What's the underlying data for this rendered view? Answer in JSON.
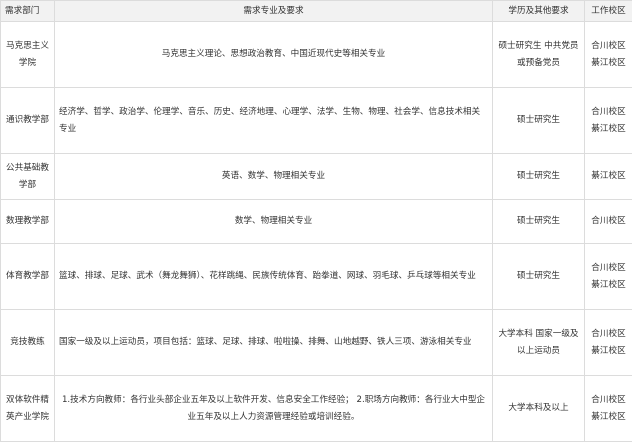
{
  "headers": {
    "dept": "需求部门",
    "spec": "需求专业及要求",
    "edu": "学历及其他要求",
    "campus": "工作校区"
  },
  "rows": [
    {
      "dept": "马克思主义学院",
      "spec": "马克思主义理论、思想政治教育、中国近现代史等相关专业",
      "edu": "硕士研究生 中共党员或预备党员",
      "campus": "合川校区 綦江校区"
    },
    {
      "dept": "通识教学部",
      "spec": "经济学、哲学、政治学、伦理学、音乐、历史、经济地理、心理学、法学、生物、物理、社会学、信息技术相关专业",
      "edu": "硕士研究生",
      "campus": "合川校区 綦江校区"
    },
    {
      "dept": "公共基础教学部",
      "spec": "英语、数学、物理相关专业",
      "edu": "硕士研究生",
      "campus": "綦江校区"
    },
    {
      "dept": "数理教学部",
      "spec": "数学、物理相关专业",
      "edu": "硕士研究生",
      "campus": "合川校区"
    },
    {
      "dept": "体育教学部",
      "spec": "篮球、排球、足球、武术（舞龙舞狮）、花样跳绳、民族传统体育、跆拳道、网球、羽毛球、乒乓球等相关专业",
      "edu": "硕士研究生",
      "campus": "合川校区 綦江校区"
    },
    {
      "dept": "竞技教练",
      "spec": "国家一级及以上运动员，项目包括：篮球、足球、排球、啦啦操、排舞、山地越野、铁人三项、游泳相关专业",
      "edu": "大学本科 国家一级及以上运动员",
      "campus": "合川校区 綦江校区"
    },
    {
      "dept": "双体软件精英产业学院",
      "spec": "1.技术方向教师：各行业头部企业五年及以上软件开发、信息安全工作经验； 2.职场方向教师：各行业大中型企业五年及以上人力资源管理经验或培训经验。",
      "edu": "大学本科及以上",
      "campus": "合川校区 綦江校区"
    }
  ]
}
